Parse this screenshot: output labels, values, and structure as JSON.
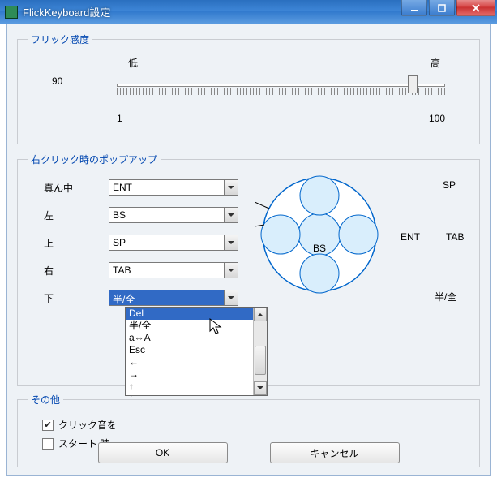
{
  "window": {
    "title": "FlickKeyboard設定"
  },
  "group_sensitivity": {
    "legend": "フリック感度",
    "low_label": "低",
    "high_label": "高",
    "value": "90",
    "scale_min": "1",
    "scale_max": "100",
    "thumb_pos": 0.9
  },
  "group_popup": {
    "legend": "右クリック時のポップアップ",
    "rows": [
      {
        "label": "真ん中",
        "value": "ENT"
      },
      {
        "label": "左",
        "value": "BS"
      },
      {
        "label": "上",
        "value": "SP"
      },
      {
        "label": "右",
        "value": "TAB"
      },
      {
        "label": "下",
        "value": "半/全"
      }
    ],
    "diagram": {
      "up": "SP",
      "left": "",
      "center": "BS",
      "right_inner": "ENT",
      "right_outer": "TAB",
      "down": "半/全"
    },
    "dropdown_open": {
      "items": [
        "Del",
        "半/全",
        "a⇔A",
        "Esc",
        "←",
        "→",
        "↑",
        "↓"
      ],
      "highlight_index": 0
    }
  },
  "group_other": {
    "legend": "その他",
    "click_sound": {
      "label": "クリック音を",
      "checked": true
    },
    "start_time": {
      "label": "スタート 時",
      "checked": false
    }
  },
  "buttons": {
    "ok": "OK",
    "cancel": "キャンセル"
  }
}
